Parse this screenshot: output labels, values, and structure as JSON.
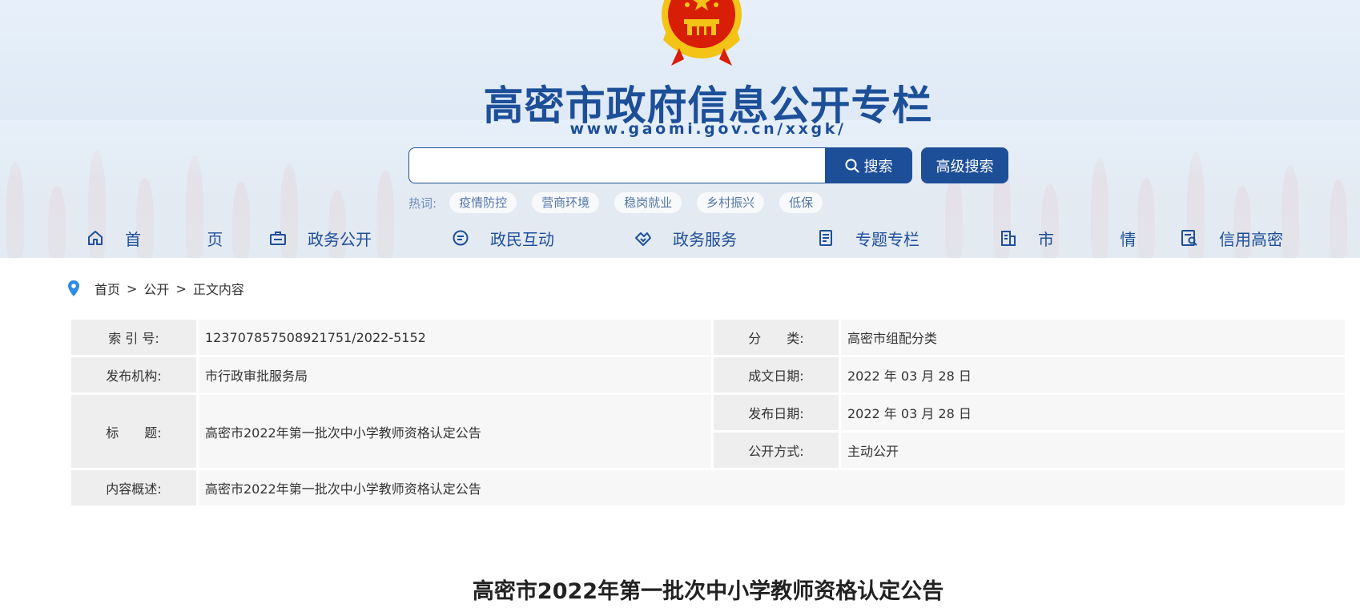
{
  "header": {
    "title": "高密市政府信息公开专栏",
    "url": "www.gaomi.gov.cn/xxgk/"
  },
  "search": {
    "value": "",
    "placeholder": "",
    "button_label": "搜索",
    "advanced_label": "高级搜索"
  },
  "hotwords": {
    "label": "热词:",
    "items": [
      "疫情防控",
      "营商环境",
      "稳岗就业",
      "乡村振兴",
      "低保"
    ]
  },
  "nav": {
    "items": [
      {
        "label": "首 页",
        "icon": "home-icon"
      },
      {
        "label": "政务公开",
        "icon": "briefcase-icon"
      },
      {
        "label": "政民互动",
        "icon": "chat-icon"
      },
      {
        "label": "政务服务",
        "icon": "handshake-icon"
      },
      {
        "label": "专题专栏",
        "icon": "document-icon"
      },
      {
        "label": "市 情",
        "icon": "building-icon"
      },
      {
        "label": "信用高密",
        "icon": "credit-search-icon"
      }
    ]
  },
  "breadcrumb": {
    "icon": "location-pin-icon",
    "items": [
      "首页",
      "公开",
      "正文内容"
    ],
    "separator": ">"
  },
  "info": {
    "index_label": "索 引 号:",
    "index_value": "123707857508921751/2022-5152",
    "category_label": "分　　类:",
    "category_value": "高密市组配分类",
    "publisher_label": "发布机构:",
    "publisher_value": "市行政审批服务局",
    "created_label": "成文日期:",
    "created_value": "2022 年 03 月 28 日",
    "title_label": "标　　题:",
    "title_value": "高密市2022年第一批次中小学教师资格认定公告",
    "published_label": "发布日期:",
    "published_value": "2022 年 03 月 28 日",
    "disclosure_label": "公开方式:",
    "disclosure_value": "主动公开",
    "summary_label": "内容概述:",
    "summary_value": "高密市2022年第一批次中小学教师资格认定公告"
  },
  "article": {
    "title": "高密市2022年第一批次中小学教师资格认定公告"
  },
  "colors": {
    "brand_blue": "#1d4f99",
    "emblem_red": "#d81e06",
    "emblem_gold": "#f3c316"
  }
}
